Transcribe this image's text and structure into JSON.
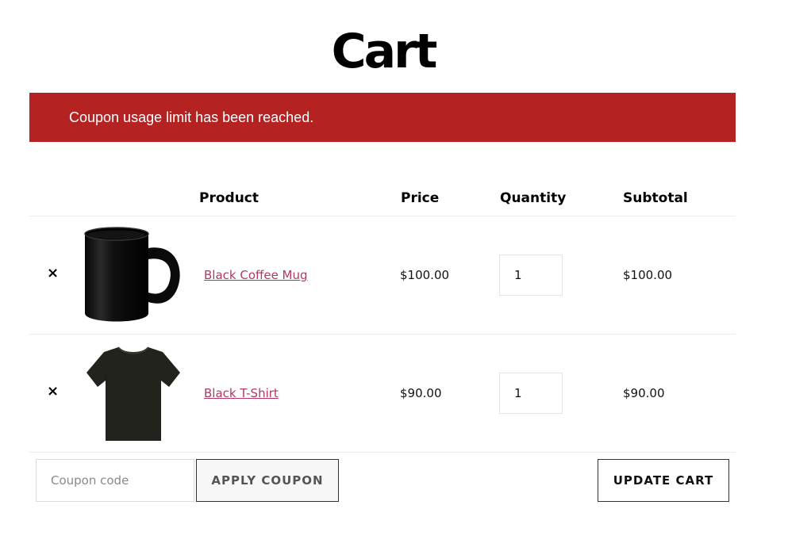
{
  "page": {
    "title": "Cart"
  },
  "notice": {
    "message": "Coupon usage limit has been reached.",
    "color": "#b42222"
  },
  "table": {
    "headers": {
      "product": "Product",
      "price": "Price",
      "quantity": "Quantity",
      "subtotal": "Subtotal"
    },
    "items": [
      {
        "remove_glyph": "×",
        "remove_icon": "close-icon",
        "thumbnail": "black-coffee-mug-image",
        "name": "Black Coffee Mug",
        "price": "$100.00",
        "quantity": "1",
        "subtotal": "$100.00"
      },
      {
        "remove_glyph": "×",
        "remove_icon": "close-icon",
        "thumbnail": "black-t-shirt-image",
        "name": "Black T-Shirt",
        "price": "$90.00",
        "quantity": "1",
        "subtotal": "$90.00"
      }
    ]
  },
  "actions": {
    "coupon_placeholder": "Coupon code",
    "coupon_value": "",
    "apply_label": "APPLY COUPON",
    "update_label": "UPDATE CART"
  },
  "colors": {
    "link": "#b3385f",
    "border": "#ececec"
  }
}
